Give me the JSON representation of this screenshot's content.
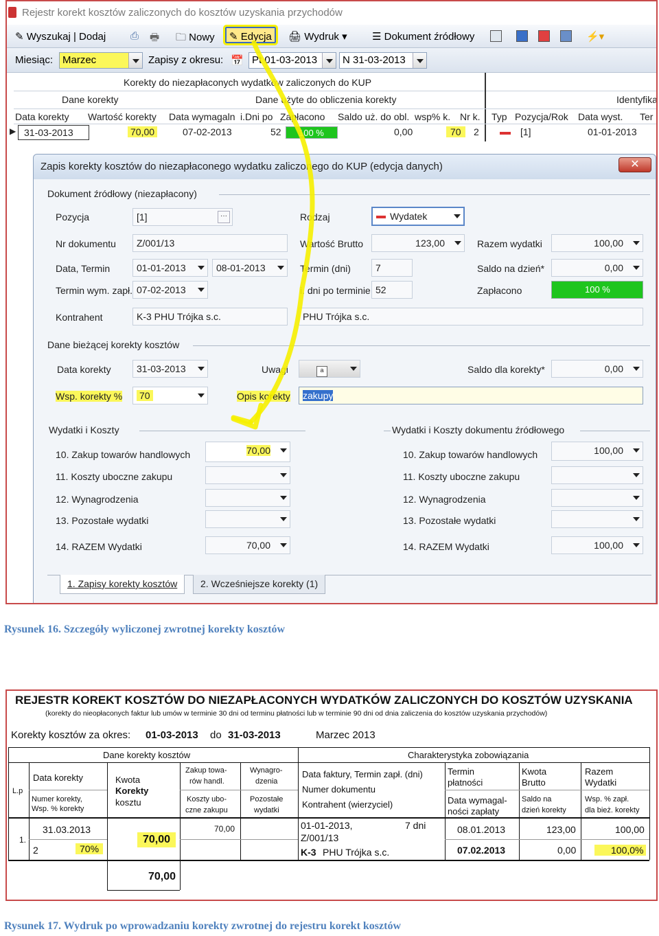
{
  "window": {
    "title": "Rejestr korekt kosztów zaliczonych do kosztów uzyskania przychodów"
  },
  "toolbar": {
    "search_add": "Wyszukaj | Dodaj",
    "new": "Nowy",
    "edit": "Edycja",
    "print": "Wydruk",
    "source_doc": "Dokument źródłowy"
  },
  "filter": {
    "month_label": "Miesiąc:",
    "month_value": "Marzec",
    "period_label": "Zapisy z okresu:",
    "from": "Pt 01-03-2013",
    "to": "N 31-03-2013"
  },
  "grid": {
    "title": "Korekty do niezapłaconych wydatków zaliczonych do KUP",
    "group1": "Dane korekty",
    "group2": "Dane użyte do obliczenia korekty",
    "group3": "Identyfika",
    "columns": [
      "Data korekty",
      "Wartość korekty",
      "Data wymagaln",
      "i.Dni po",
      "Zapłacono",
      "Saldo uż. do obl.",
      "wsp% k.",
      "Nr k.",
      "Typ",
      "Pozycja/Rok",
      "Data wyst.",
      "Ter"
    ],
    "row": {
      "date": "31-03-2013",
      "value": "70,00",
      "due": "07-02-2013",
      "days": "52",
      "paid": "100 %",
      "paid_fraction": 1.0,
      "saldo": "0,00",
      "wsp": "70",
      "nr": "2",
      "pos": "[1]",
      "issued": "01-01-2013"
    }
  },
  "dialog": {
    "title": "Zapis korekty kosztów do niezapłaconego wydatku zaliczonego do KUP  (edycja danych)",
    "close": "✕",
    "section_source": "Dokument źródłowy  (niezapłacony)",
    "pozycja_label": "Pozycja",
    "pozycja": "[1]",
    "rodzaj_label": "Rodzaj",
    "rodzaj": "Wydatek",
    "nrdok_label": "Nr dokumentu",
    "nrdok": "Z/001/13",
    "brutto_label": "Wartość Brutto",
    "brutto": "123,00",
    "razem_label": "Razem wydatki",
    "razem": "100,00",
    "data_label": "Data, Termin",
    "data": "01-01-2013",
    "termin": "08-01-2013",
    "termin_dni_label": "Termin (dni)",
    "termin_dni": "7",
    "saldo_dzien_label": "Saldo na dzień*",
    "saldo_dzien": "0,00",
    "termin_wym_label": "Termin wym. zapł.",
    "termin_wym": "07-02-2013",
    "dni_po_label": "i. dni po terminie",
    "dni_po": "52",
    "zaplacono_label": "Zapłacono",
    "zaplacono": "100 %",
    "zaplacono_fraction": 1.0,
    "kontrahent_label": "Kontrahent",
    "kontrahent": "K-3   PHU Trójka s.c.",
    "kontrahent_name": "PHU Trójka s.c.",
    "section_current": "Dane bieżącej korekty kosztów",
    "data_korekty_label": "Data korekty",
    "data_korekty": "31-03-2013",
    "uwagi_label": "Uwagi",
    "saldo_korekty_label": "Saldo dla korekty*",
    "saldo_korekty": "0,00",
    "wsp_label": "Wsp. korekty %",
    "wsp": "70",
    "opis_label": "Opis korekty",
    "opis": "zakupy",
    "section_costs": "Wydatki i Koszty",
    "section_costs_src": "Wydatki i Koszty dokumentu źródłowego",
    "rows": [
      {
        "label": "10. Zakup towarów handlowych",
        "left": "70,00",
        "right": "100,00"
      },
      {
        "label": "11. Koszty uboczne zakupu",
        "left": "",
        "right": ""
      },
      {
        "label": "12. Wynagrodzenia",
        "left": "",
        "right": ""
      },
      {
        "label": "13. Pozostałe wydatki",
        "left": "",
        "right": ""
      },
      {
        "label": "14. RAZEM Wydatki",
        "left": "70,00",
        "right": "100,00"
      }
    ],
    "tab1": "1. Zapisy korekty kosztów",
    "tab2": "2. Wcześniejsze korekty (1)"
  },
  "caption1": "Rysunek 16. Szczegóły  wyliczonej zwrotnej korekty kosztów",
  "report": {
    "title": "REJESTR KOREKT KOSZTÓW DO NIEZAPŁACONYCH WYDATKÓW ZALICZONYCH DO KOSZTÓW UZYSKANIA",
    "subtitle": "(korekty do nieopłaconych faktur lub umów w terminie 30 dni od terminu płatności lub w terminie 90 dni od dnia zaliczenia do kosztów uzyskania przychodów)",
    "period_label": "Korekty kosztów za okres:",
    "period_from": "01-03-2013",
    "period_do": "do",
    "period_to": "31-03-2013",
    "period_month": "Marzec 2013",
    "hdr_dane": "Dane korekty kosztów",
    "hdr_char": "Charakterystyka zobowiązania",
    "h_lp": "L.p",
    "h_data": "Data korekty",
    "h_numer": "Numer korekty,",
    "h_wsp": "Wsp. % korekty",
    "h_kwota1": "Kwota",
    "h_kwota2": "Korekty",
    "h_kwota3": "kosztu",
    "h_zakup1": "Zakup towa-",
    "h_zakup2": "rów handl.",
    "h_koszty1": "Koszty ubo-",
    "h_koszty2": "czne zakupu",
    "h_wyn1": "Wynagro-",
    "h_wyn2": "dzenia",
    "h_poz1": "Pozostałe",
    "h_poz2": "wydatki",
    "h_faktury": "Data faktury, Termin zapł. (dni)",
    "h_numerdok": "Numer dokumentu",
    "h_kontr": "Kontrahent (wierzyciel)",
    "h_term1": "Termin",
    "h_term2": "płatności",
    "h_wym1": "Data wymagal-",
    "h_wym2": "ności zapłaty",
    "h_kb1": "Kwota",
    "h_kb2": "Brutto",
    "h_sal1": "Saldo na",
    "h_sal2": "dzień korekty",
    "h_raz1": "Razem",
    "h_raz2": "Wydatki",
    "h_wz1": "Wsp. % zapł.",
    "h_wz2": "dla bież. korekty",
    "r_lp": "1.",
    "r_date": "31.03.2013",
    "r_nr": "2",
    "r_wsp": "70%",
    "r_kwota": "70,00",
    "r_zakup": "70,00",
    "r_fdate": "01-01-2013,",
    "r_fdays": "7 dni",
    "r_doc": "Z/001/13",
    "r_k": "K-3",
    "r_kname": "PHU Trójka s.c.",
    "r_term": "08.01.2013",
    "r_wym": "07.02.2013",
    "r_brutto": "123,00",
    "r_saldo": "0,00",
    "r_razem": "100,00",
    "r_wz": "100,0%",
    "total": "70,00"
  },
  "caption2": "Rysunek 17. Wydruk po wprowadzaniu korekty zwrotnej do rejestru korekt kosztów"
}
